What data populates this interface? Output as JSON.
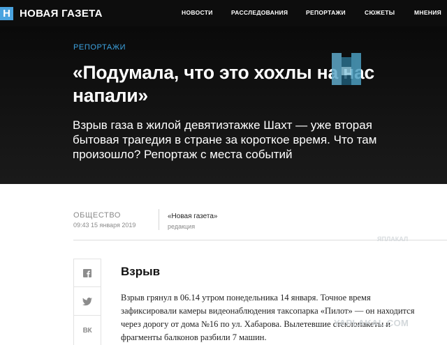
{
  "header": {
    "logo_mark": "Н",
    "logo_text": "НОВАЯ ГАЗЕТА",
    "nav": [
      "НОВОСТИ",
      "РАССЛЕДОВАНИЯ",
      "РЕПОРТАЖИ",
      "СЮЖЕТЫ",
      "МНЕНИЯ"
    ]
  },
  "article": {
    "rubric": "РЕПОРТАЖИ",
    "headline": "«Подумала, что это хохлы на нас напали»",
    "lead": "Взрыв газа в жилой девятиэтажке Шахт — уже вторая бытовая трагедия в стране за короткое время. Что там произошло? Репортаж с места событий",
    "section": "ОБЩЕСТВО",
    "date": "09:43 15 января 2019",
    "author": "«Новая газета»",
    "author_role": "редакция",
    "subheading": "Взрыв",
    "body": "Взрыв грянул в 06.14 утром понедельника 14 января. Точное время зафиксировали камеры видеонаблюдения таксопарка «Пилот» — он находится через дорогу от дома №16 по ул. Хабарова. Вылетевшие стеклопакеты и фрагменты балконов разбили 7 машин."
  },
  "share": {
    "facebook_icon": "facebook-icon",
    "twitter_icon": "twitter-icon",
    "vk_label": "ВК"
  },
  "watermark": {
    "text": "YAPLAKAL.COM",
    "top_text": "ЯПЛАКАЛ"
  },
  "colors": {
    "accent_blue": "#3da3e0",
    "logo_blue": "#4aa3df",
    "header_bg": "#0d0d0d"
  }
}
